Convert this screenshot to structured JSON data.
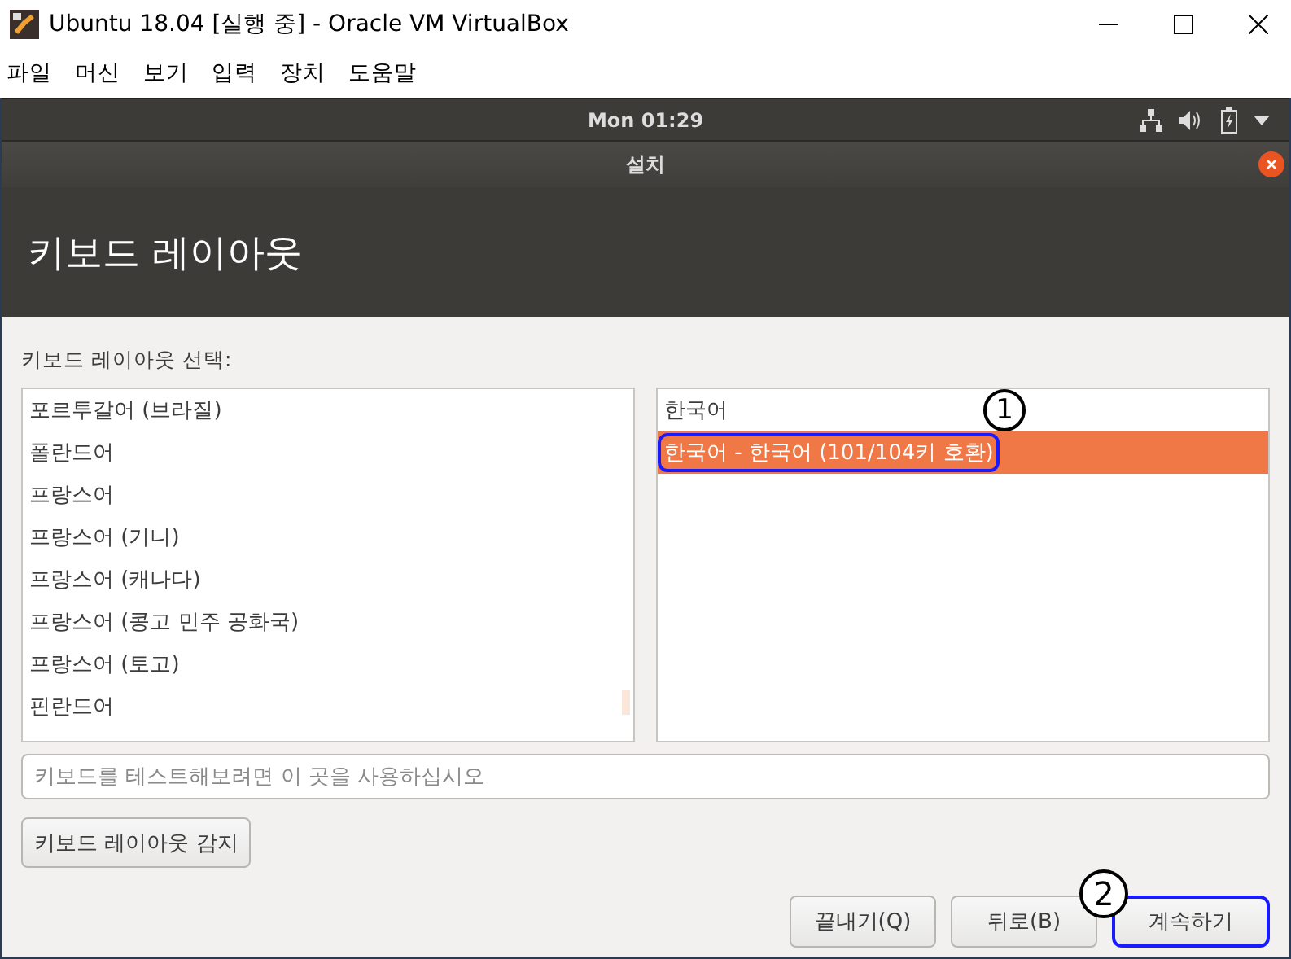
{
  "window": {
    "title": "Ubuntu 18.04 [실행 중] - Oracle VM VirtualBox"
  },
  "menu": [
    "파일",
    "머신",
    "보기",
    "입력",
    "장치",
    "도움말"
  ],
  "top_bar": {
    "clock": "Mon 01:29"
  },
  "installer": {
    "title": "설치",
    "heading": "키보드 레이아웃"
  },
  "layout_label": "키보드 레이아웃 선택:",
  "layouts": [
    {
      "label": "포르투갈어 (브라질)",
      "selected": false
    },
    {
      "label": "폴란드어",
      "selected": false
    },
    {
      "label": "프랑스어",
      "selected": false
    },
    {
      "label": "프랑스어 (기니)",
      "selected": false
    },
    {
      "label": "프랑스어 (캐나다)",
      "selected": false
    },
    {
      "label": "프랑스어 (콩고 민주 공화국)",
      "selected": false
    },
    {
      "label": "프랑스어 (토고)",
      "selected": false
    },
    {
      "label": "핀란드어",
      "selected": false
    }
  ],
  "variants": [
    {
      "label": "한국어",
      "selected": false
    },
    {
      "label": "한국어 - 한국어 (101/104키 호환)",
      "selected": true,
      "annotation": "1"
    }
  ],
  "test_field": {
    "placeholder": "키보드를 테스트해보려면 이 곳을 사용하십시오"
  },
  "detect_button": "키보드 레이아웃 감지",
  "buttons": [
    {
      "label": "끝내기(Q)"
    },
    {
      "label": "뒤로(B)"
    },
    {
      "label": "계속하기",
      "annotation": "2"
    }
  ]
}
